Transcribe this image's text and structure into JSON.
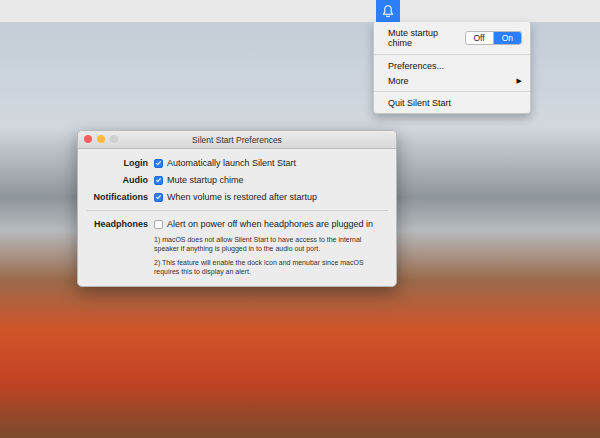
{
  "menubar": {
    "status_item": {
      "selected": true
    }
  },
  "menu": {
    "items": [
      {
        "kind": "toggle",
        "label": "Mute startup chime",
        "options": [
          {
            "label": "Off",
            "selected": false
          },
          {
            "label": "On",
            "selected": true
          }
        ]
      },
      {
        "kind": "separator"
      },
      {
        "kind": "item",
        "label": "Preferences..."
      },
      {
        "kind": "submenu",
        "label": "More",
        "arrow": "▶"
      },
      {
        "kind": "separator"
      },
      {
        "kind": "item",
        "label": "Quit Silent Start"
      }
    ]
  },
  "window": {
    "title": "Silent Start Preferences",
    "rows": [
      {
        "label": "Login",
        "option": "Automatically launch Silent Start",
        "checked": true
      },
      {
        "label": "Audio",
        "option": "Mute startup chime",
        "checked": true
      },
      {
        "label": "Notifications",
        "option": "When volume is restored after startup",
        "checked": true
      }
    ],
    "headphones": {
      "label": "Headphones",
      "option": "Alert on power off when headphones are plugged in",
      "checked": false,
      "notes": [
        "1) macOS does not allow Silent Start to have access to the internal speaker if anything is plugged in to the audio out port.",
        "2) This feature will enable the dock icon and menubar since macOS requires this to display an alert."
      ]
    }
  }
}
